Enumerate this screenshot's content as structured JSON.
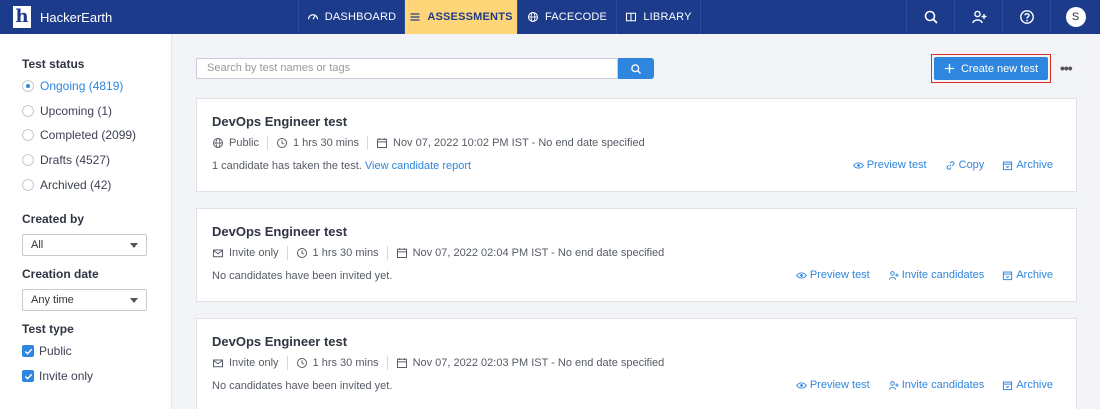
{
  "app": {
    "name": "HackerEarth",
    "logo_letter": "h"
  },
  "nav": {
    "items": [
      {
        "label": "DASHBOARD",
        "icon": "dashboard-icon",
        "active": false
      },
      {
        "label": "ASSESSMENTS",
        "icon": "list-icon",
        "active": true
      },
      {
        "label": "FACECODE",
        "icon": "globe-icon",
        "active": false
      },
      {
        "label": "LIBRARY",
        "icon": "book-icon",
        "active": false
      }
    ],
    "right_icons": [
      "search-icon",
      "add-user-icon",
      "help-icon"
    ],
    "avatar_initial": "S"
  },
  "colors": {
    "navbar": "#1d3b8b",
    "active_tab": "#ffd57a",
    "accent": "#2e86de"
  },
  "sidebar": {
    "test_status_heading": "Test status",
    "statuses": [
      {
        "label": "Ongoing (4819)",
        "selected": true
      },
      {
        "label": "Upcoming (1)",
        "selected": false
      },
      {
        "label": "Completed (2099)",
        "selected": false
      },
      {
        "label": "Drafts (4527)",
        "selected": false
      },
      {
        "label": "Archived (42)",
        "selected": false
      }
    ],
    "created_by_heading": "Created by",
    "created_by_value": "All",
    "creation_date_heading": "Creation date",
    "creation_date_value": "Any time",
    "test_type_heading": "Test type",
    "test_types": [
      {
        "label": "Public",
        "checked": true
      },
      {
        "label": "Invite only",
        "checked": true
      }
    ]
  },
  "search": {
    "placeholder": "Search by test names or tags"
  },
  "create_button": "Create new test",
  "more_label": "•••",
  "tests": [
    {
      "title": "DevOps Engineer test",
      "visibility": "Public",
      "visibility_icon": "globe-icon",
      "duration": "1 hrs 30 mins",
      "schedule": "Nov 07, 2022 10:02 PM IST - No end date specified",
      "status_text": "1 candidate has taken the test.",
      "status_link": "View candidate report",
      "actions": [
        "Preview test",
        "Copy",
        "Archive"
      ]
    },
    {
      "title": "DevOps Engineer test",
      "visibility": "Invite only",
      "visibility_icon": "mail-icon",
      "duration": "1 hrs 30 mins",
      "schedule": "Nov 07, 2022 02:04 PM IST - No end date specified",
      "status_text": "No candidates have been invited yet.",
      "status_link": "",
      "actions": [
        "Preview test",
        "Invite candidates",
        "Archive"
      ]
    },
    {
      "title": "DevOps Engineer test",
      "visibility": "Invite only",
      "visibility_icon": "mail-icon",
      "duration": "1 hrs 30 mins",
      "schedule": "Nov 07, 2022 02:03 PM IST - No end date specified",
      "status_text": "No candidates have been invited yet.",
      "status_link": "",
      "actions": [
        "Preview test",
        "Invite candidates",
        "Archive"
      ]
    }
  ]
}
